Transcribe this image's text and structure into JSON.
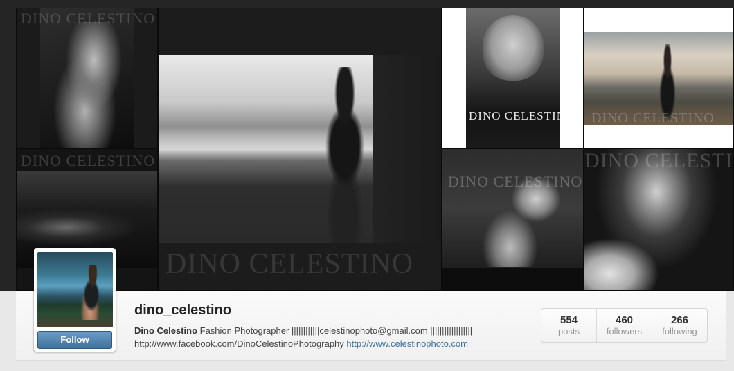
{
  "watermark": "DINO CELESTINO",
  "profile": {
    "username": "dino_celestino",
    "full_name": "Dino Celestino",
    "bio_line1": "Fashion Photographer ||||||||||||celestinophoto@gmail.com ||||||||||||||||||",
    "facebook_url": "http://www.facebook.com/DinoCelestinoPhotography",
    "website_url": "http://www.celestinophoto.com",
    "follow_label": "Follow"
  },
  "stats": [
    {
      "value": "554",
      "label": "posts"
    },
    {
      "value": "460",
      "label": "followers"
    },
    {
      "value": "266",
      "label": "following"
    }
  ],
  "mosaic": {
    "tiles": [
      {
        "name": "photo-tile-1",
        "content": "photo"
      },
      {
        "name": "photo-tile-2",
        "content": "photo"
      },
      {
        "name": "photo-tile-large",
        "content": "photo"
      },
      {
        "name": "photo-tile-3",
        "content": "photo"
      },
      {
        "name": "photo-tile-4",
        "content": "photo"
      },
      {
        "name": "photo-tile-5",
        "content": "photo"
      },
      {
        "name": "photo-tile-6",
        "content": "photo"
      }
    ]
  },
  "colors": {
    "link": "#3f729b",
    "follow_button": "#3f729b",
    "background_dark": "#252525",
    "background_light": "#e8e8e8"
  }
}
